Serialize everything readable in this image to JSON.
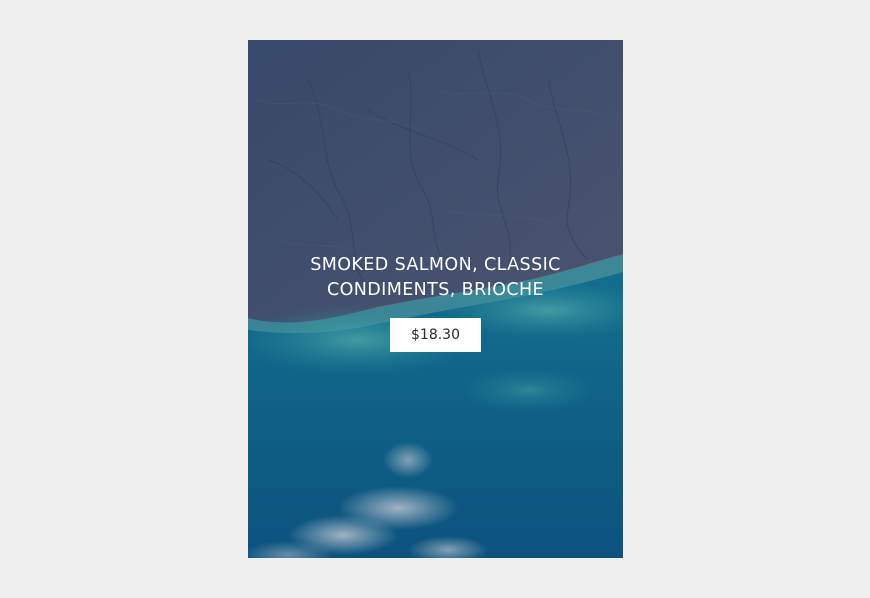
{
  "product": {
    "title_line1": "SMOKED SALMON, CLASSIC",
    "title_line2": "CONDIMENTS, BRIOCHE",
    "price": "$18.30"
  },
  "colors": {
    "page_background": "#efefef",
    "button_background": "#ffffff",
    "title_text": "#ffffff",
    "price_text": "#2a2a2a"
  },
  "image": {
    "subject": "aerial-earth-coastline"
  }
}
